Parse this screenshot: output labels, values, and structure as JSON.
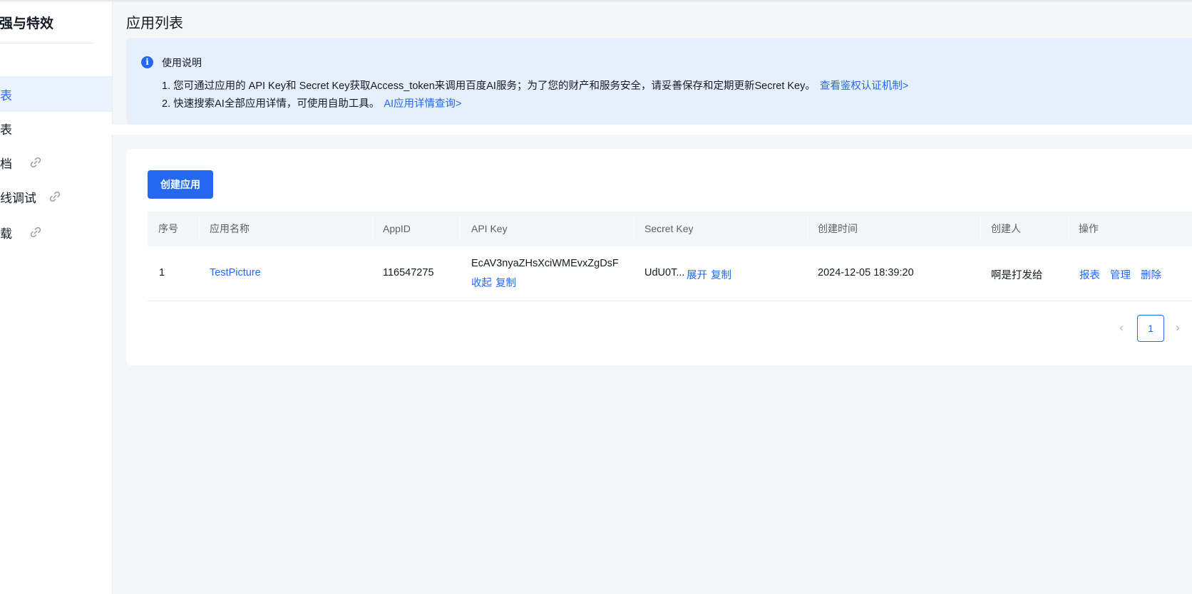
{
  "sidebar": {
    "title": "增强与特效",
    "items": [
      {
        "label": "列表",
        "active": true,
        "external": false
      },
      {
        "label": "报表",
        "active": false,
        "external": false
      },
      {
        "label": "文档",
        "active": false,
        "external": true
      },
      {
        "label": "在线调试",
        "active": false,
        "external": true
      },
      {
        "label": "下载",
        "active": false,
        "external": true
      }
    ]
  },
  "page": {
    "title": "应用列表"
  },
  "notice": {
    "title": "使用说明",
    "line1": "1. 您可通过应用的 API Key和 Secret Key获取Access_token来调用百度AI服务；为了您的财产和服务安全，请妥善保存和定期更新Secret Key。",
    "line1_link": "查看鉴权认证机制>",
    "line2": "2. 快速搜索AI全部应用详情，可使用自助工具。",
    "line2_link": "AI应用详情查询>"
  },
  "toolbar": {
    "create_label": "创建应用"
  },
  "table": {
    "columns": [
      "序号",
      "应用名称",
      "AppID",
      "API Key",
      "Secret Key",
      "创建时间",
      "创建人",
      "操作"
    ],
    "rows": [
      {
        "index": "1",
        "name": "TestPicture",
        "app_id": "116547275",
        "api_key": "EcAV3nyaZHsXciWMEvxZgDsF",
        "api_key_actions": {
          "collapse": "收起",
          "copy": "复制"
        },
        "secret_key": "UdU0T...",
        "secret_key_actions": {
          "expand": "展开",
          "copy": "复制"
        },
        "created_at": "2024-12-05 18:39:20",
        "creator": "啊是打发给",
        "actions": {
          "report": "报表",
          "manage": "管理",
          "delete": "删除"
        }
      }
    ]
  },
  "pagination": {
    "current_page": "1",
    "prev": "‹",
    "next": "›"
  },
  "colors": {
    "accent": "#2468f2",
    "notice_bg": "#e6effc",
    "page_bg": "#f5f6f8"
  }
}
